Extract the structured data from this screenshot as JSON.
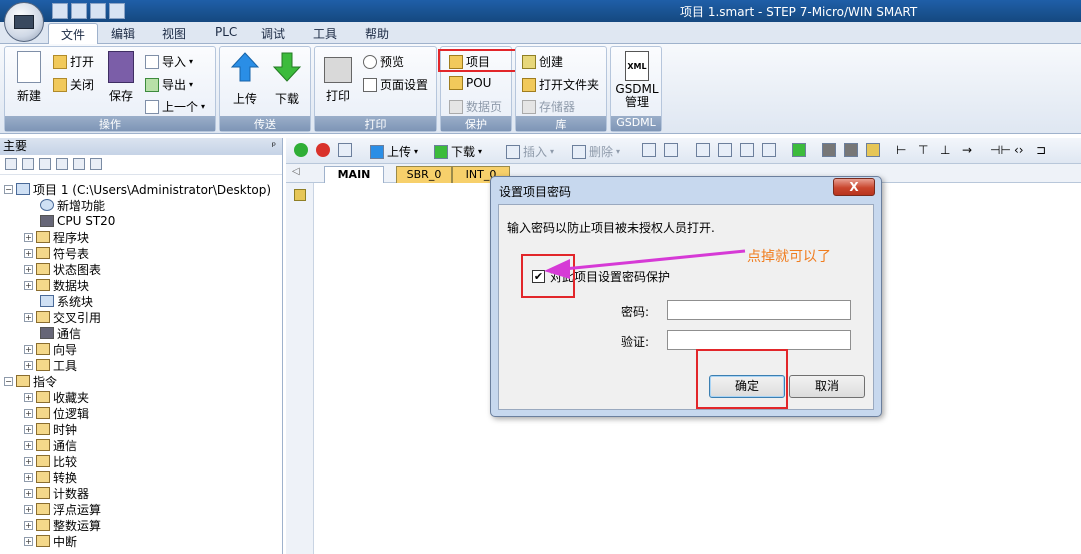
{
  "title": "项目 1.smart - STEP 7-Micro/WIN SMART",
  "menu": [
    "文件",
    "编辑",
    "视图",
    "PLC",
    "调试",
    "工具",
    "帮助"
  ],
  "ribbon": {
    "operations": {
      "label": "操作",
      "new": "新建",
      "open": "打开",
      "close": "关闭",
      "save": "保存",
      "import": "导入",
      "export": "导出",
      "previous": "上一个"
    },
    "transfer": {
      "label": "传送",
      "upload": "上传",
      "download": "下载"
    },
    "print": {
      "label": "打印",
      "print": "打印",
      "preview": "预览",
      "page_setup": "页面设置"
    },
    "protect": {
      "label": "保护",
      "project": "项目",
      "pou": "POU",
      "data_page": "数据页"
    },
    "library": {
      "label": "库",
      "create": "创建",
      "open_folder": "打开文件夹",
      "memory": "存储器"
    },
    "gsdml": {
      "label": "GSDML",
      "manage": "GSDML\n管理",
      "xml": "XML"
    }
  },
  "left_panel": {
    "title": "主要",
    "tree": [
      {
        "label": "项目 1 (C:\\Users\\Administrator\\Desktop)"
      },
      {
        "label": "新增功能"
      },
      {
        "label": "CPU ST20"
      },
      {
        "label": "程序块"
      },
      {
        "label": "符号表"
      },
      {
        "label": "状态图表"
      },
      {
        "label": "数据块"
      },
      {
        "label": "系统块"
      },
      {
        "label": "交叉引用"
      },
      {
        "label": "通信"
      },
      {
        "label": "向导"
      },
      {
        "label": "工具"
      },
      {
        "label": "指令"
      },
      {
        "label": "收藏夹"
      },
      {
        "label": "位逻辑"
      },
      {
        "label": "时钟"
      },
      {
        "label": "通信"
      },
      {
        "label": "比较"
      },
      {
        "label": "转换"
      },
      {
        "label": "计数器"
      },
      {
        "label": "浮点运算"
      },
      {
        "label": "整数运算"
      },
      {
        "label": "中断"
      }
    ]
  },
  "editor_toolbar": {
    "upload": "上传",
    "download": "下载",
    "insert": "插入",
    "delete": "删除"
  },
  "program_tabs": [
    "MAIN",
    "SBR_0",
    "INT_0"
  ],
  "dialog": {
    "title": "设置项目密码",
    "close": "X",
    "message": "输入密码以防止项目被未授权人员打开.",
    "checkbox_label": "对此项目设置密码保护",
    "checkbox_checked": true,
    "password_label": "密码:",
    "verify_label": "验证:",
    "ok": "确定",
    "cancel": "取消"
  },
  "annotation": "点掉就可以了",
  "colors": {
    "highlight": "#e2262a",
    "arrow": "#d63ad6",
    "annotation": "#f07d1f"
  }
}
